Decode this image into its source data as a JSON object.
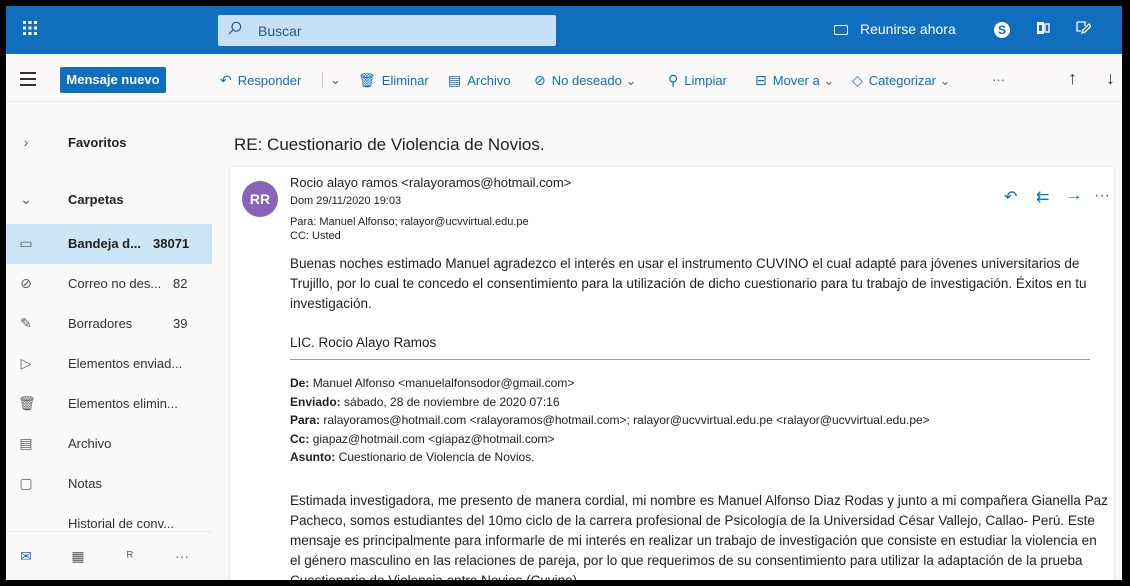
{
  "topbar": {
    "search_placeholder": "Buscar",
    "meet_now": "Reunirse ahora",
    "skype_letter": "S"
  },
  "toolbar": {
    "new_message": "Mensaje nuevo",
    "reply": "Responder",
    "delete": "Eliminar",
    "archive": "Archivo",
    "junk": "No deseado",
    "sweep": "Limpiar",
    "move_to": "Mover a",
    "categorize": "Categorizar",
    "more": "···"
  },
  "sidebar": {
    "favorites": "Favoritos",
    "folders": "Carpetas",
    "items": [
      {
        "label": "Bandeja d...",
        "count": "38071"
      },
      {
        "label": "Correo no des...",
        "count": "82"
      },
      {
        "label": "Borradores",
        "count": "39"
      },
      {
        "label": "Elementos enviad...",
        "count": ""
      },
      {
        "label": "Elementos elimin...",
        "count": ""
      },
      {
        "label": "Archivo",
        "count": ""
      },
      {
        "label": "Notas",
        "count": ""
      },
      {
        "label": "Historial de conv...",
        "count": ""
      }
    ],
    "more": "···"
  },
  "message": {
    "subject": "RE: Cuestionario de Violencia de Novios.",
    "avatar_initials": "RR",
    "sender": "Rocio alayo ramos <ralayoramos@hotmail.com>",
    "date": "Dom 29/11/2020 19:03",
    "to_label": "Para:",
    "to_value": "Manuel Alfonso; ralayor@ucvvirtual.edu.pe",
    "cc_label": "CC:",
    "cc_value": "Usted",
    "body": "Buenas noches estimado Manuel agradezco el interés en usar el instrumento CUVINO el cual adapté para jóvenes universitarios de Trujillo, por lo cual te concedo el consentimiento para la utilización de dicho cuestionario para tu trabajo de investigación. Éxitos en tu investigación.",
    "signature": "LIC. Rocio Alayo Ramos",
    "forward": {
      "from_label": "De:",
      "from_value": "Manuel Alfonso <manuelalfonsodor@gmail.com>",
      "sent_label": "Enviado:",
      "sent_value": "sábado, 28 de noviembre de 2020 07:16",
      "to_label": "Para:",
      "to_value": "ralayoramos@hotmail.com <ralayoramos@hotmail.com>; ralayor@ucvvirtual.edu.pe <ralayor@ucvvirtual.edu.pe>",
      "cc_label": "Cc:",
      "cc_value": "giapaz@hotmail.com <giapaz@hotmail.com>",
      "subject_label": "Asunto:",
      "subject_value": "Cuestionario de Violencia de Novios."
    },
    "body2": "Estimada investigadora, me presento de manera cordial, mi nombre es Manuel Alfonso Diaz Rodas y junto a mi compañera Gianella Paz Pacheco, somos estudiantes del 10mo ciclo de la carrera profesional de Psicología de la Universidad César Vallejo, Callao- Perú. Este mensaje es principalmente para informarle de mi interés en realizar un trabajo de investigación que consiste en estudiar la violencia en el género masculino en las relaciones de pareja, por lo que requerimos de su consentimiento para utilizar la adaptación de la prueba Cuestionario de Violencia entre Novios (Cuvino)."
  }
}
